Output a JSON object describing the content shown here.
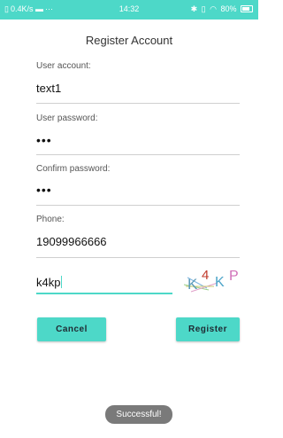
{
  "status_bar": {
    "speed": "0.4K/s",
    "time": "14:32",
    "battery": "80%",
    "color": "#4dd8c8"
  },
  "title": "Register Account",
  "fields": [
    {
      "label": "User account:",
      "value": "text1"
    },
    {
      "label": "User password:",
      "value": "•••"
    },
    {
      "label": "Confirm password:",
      "value": "•••"
    },
    {
      "label": "Phone:",
      "value": "19099966666"
    }
  ],
  "captcha": {
    "input_value": "k4kp",
    "image_text": "K4KP"
  },
  "buttons": {
    "cancel_label": "Cancel",
    "register_label": "Register"
  },
  "toast": "Successful!",
  "accent_color": "#4dd8c8"
}
